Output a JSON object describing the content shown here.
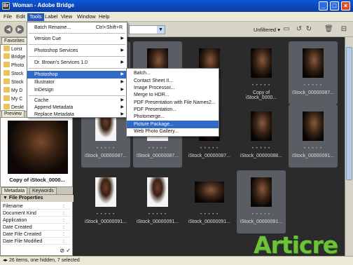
{
  "window": {
    "title": "Woman - Adobe Bridge",
    "app_icon": "Br"
  },
  "menubar": [
    "File",
    "Edit",
    "Tools",
    "Label",
    "View",
    "Window",
    "Help"
  ],
  "toolbar": {
    "filter_label": "Unfiltered"
  },
  "tools_menu": {
    "items": [
      {
        "label": "Batch Rename...",
        "shortcut": "Ctrl+Shift+R"
      },
      {
        "label": "Version Cue",
        "submenu": true
      },
      {
        "label": "Photoshop Services",
        "submenu": true
      },
      {
        "label": "Dr. Brown's Services 1.0",
        "submenu": true
      },
      {
        "label": "Photoshop",
        "submenu": true
      },
      {
        "label": "Illustrator",
        "submenu": true
      },
      {
        "label": "InDesign",
        "submenu": true
      },
      {
        "label": "Cache",
        "submenu": true
      },
      {
        "label": "Append Metadata",
        "submenu": true
      },
      {
        "label": "Replace Metadata",
        "submenu": true
      }
    ]
  },
  "photoshop_submenu": {
    "items": [
      "Batch...",
      "Contact Sheet II...",
      "Image Processor...",
      "Merge to HDR...",
      "PDF Presentation with File Names2...",
      "PDF Presentation...",
      "Photomerge...",
      "Picture Package...",
      "Web Photo Gallery..."
    ]
  },
  "left_panel": {
    "tabs": {
      "favorites": "Favorites",
      "preview": "Preview",
      "metadata": "Metadata",
      "keywords": "Keywords"
    },
    "favorites": [
      "Lorst",
      "Bridge",
      "Photo",
      "Stock",
      "Stock",
      "My D",
      "My C",
      "Deskt"
    ],
    "preview_caption": "Copy of iStock_0000...",
    "file_properties": {
      "header": "File Properties",
      "rows": [
        "Filename",
        "Document Kind",
        "Application",
        "Date Created",
        "Date File Created",
        "Date File Modified"
      ]
    }
  },
  "thumbnails": [
    {
      "label": "",
      "style": "light",
      "selected": true
    },
    {
      "label": "",
      "style": "dark",
      "selected": true
    },
    {
      "label": "",
      "style": "dark",
      "selected": false
    },
    {
      "label": "Copy of iStock_0000...",
      "style": "dark",
      "selected": false
    },
    {
      "label": "iStock_00000087...",
      "style": "dark",
      "selected": true
    },
    {
      "label": "iStock_00000087...",
      "style": "light",
      "selected": true
    },
    {
      "label": "iStock_00000087...",
      "style": "light",
      "selected": true
    },
    {
      "label": "iStock_00000087...",
      "style": "dark",
      "selected": false
    },
    {
      "label": "iStock_00000088...",
      "style": "dark",
      "selected": false
    },
    {
      "label": "iStock_00000091...",
      "style": "dark",
      "selected": true
    },
    {
      "label": "iStock_00000091...",
      "style": "light",
      "selected": false
    },
    {
      "label": "iStock_00000091...",
      "style": "light",
      "selected": false
    },
    {
      "label": "iStock_00000091...",
      "style": "land",
      "selected": false
    },
    {
      "label": "iStock_00000091...",
      "style": "dark",
      "selected": true
    }
  ],
  "thumb_dots": "• • • • •",
  "status": "26 items, one hidden, 7 selected",
  "watermark": "Articre"
}
